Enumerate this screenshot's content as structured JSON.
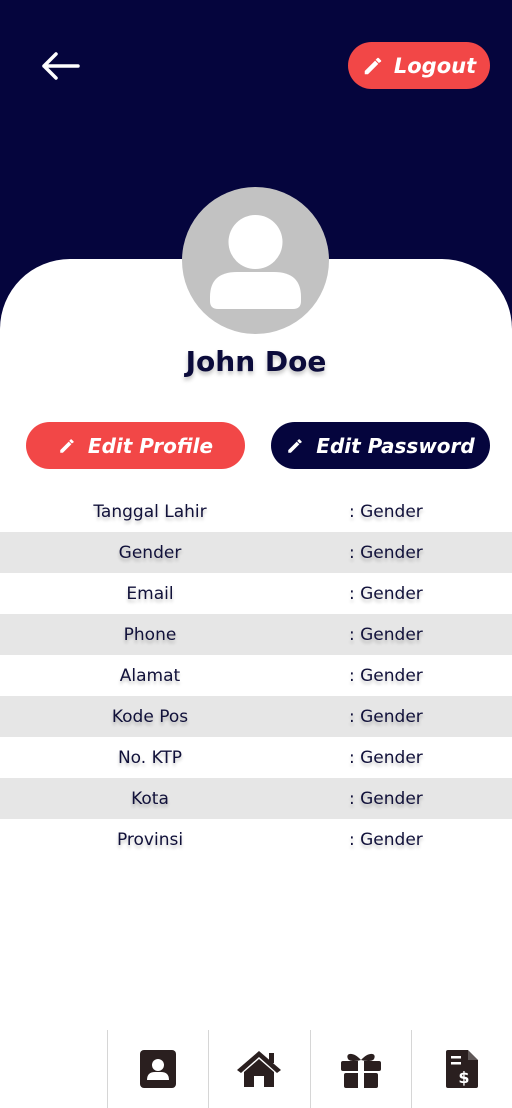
{
  "header": {
    "logout_label": "Logout",
    "colors": {
      "navy": "#05053d",
      "accent": "#f24747",
      "avatar": "#c2c2c2"
    },
    "icons": {
      "back": "arrow-left-icon",
      "logout": "pencil-icon"
    }
  },
  "profile": {
    "name": "John Doe",
    "avatar_icon": "user-silhouette-icon"
  },
  "actions": {
    "edit_profile_label": "Edit Profile",
    "edit_password_label": "Edit Password"
  },
  "info": [
    {
      "label": "Tanggal Lahir",
      "value": ": Gender"
    },
    {
      "label": "Gender",
      "value": ": Gender"
    },
    {
      "label": "Email",
      "value": ": Gender"
    },
    {
      "label": "Phone",
      "value": ": Gender"
    },
    {
      "label": "Alamat",
      "value": ": Gender"
    },
    {
      "label": "Kode Pos",
      "value": ": Gender"
    },
    {
      "label": "No. KTP",
      "value": ": Gender"
    },
    {
      "label": "Kota",
      "value": ": Gender"
    },
    {
      "label": "Provinsi",
      "value": ": Gender"
    }
  ],
  "nav": [
    {
      "icon": "profile-card-icon"
    },
    {
      "icon": "home-icon"
    },
    {
      "icon": "gift-icon"
    },
    {
      "icon": "invoice-icon"
    }
  ]
}
